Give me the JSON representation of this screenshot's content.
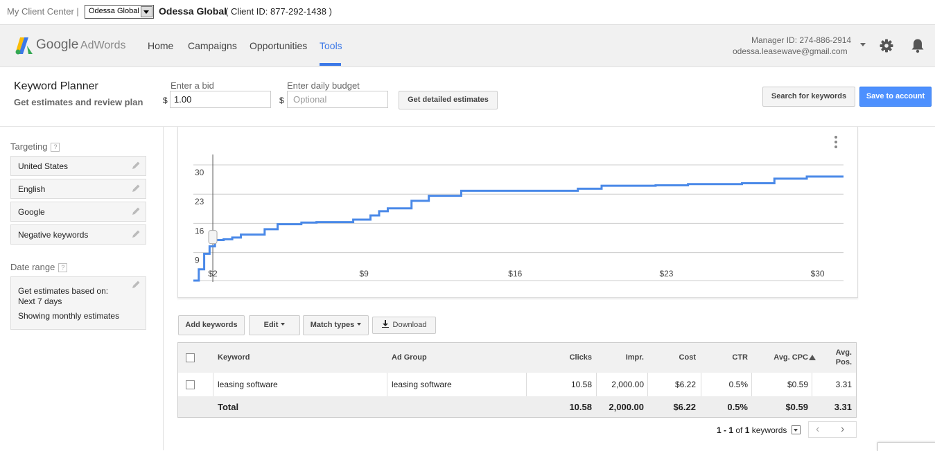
{
  "client_bar": {
    "my_client_center": "My Client Center |",
    "account_select": "Odessa Global",
    "account_name": "Odessa Global",
    "client_id": "( Client ID: 877-292-1438 )"
  },
  "nav": {
    "logo_google": "Google",
    "logo_adwords": "AdWords",
    "tabs": [
      {
        "label": "Home"
      },
      {
        "label": "Campaigns"
      },
      {
        "label": "Opportunities"
      },
      {
        "label": "Tools",
        "active": true
      }
    ],
    "manager_id": "Manager ID: 274-886-2914",
    "manager_email": "odessa.leasewave@gmail.com",
    "icons": [
      "gear-icon",
      "bell-icon"
    ]
  },
  "planner": {
    "title": "Keyword Planner",
    "subtitle": "Get estimates and review plan",
    "bid_label": "Enter a bid",
    "bid_currency": "$",
    "bid_value": "1.00",
    "budget_label": "Enter daily budget",
    "budget_currency": "$",
    "budget_placeholder": "Optional",
    "detail_button": "Get detailed estimates",
    "search_button": "Search for keywords",
    "save_button": "Save to account"
  },
  "sidebar": {
    "targeting_label": "Targeting",
    "help_glyph": "?",
    "targeting_items": [
      "United States",
      "English",
      "Google",
      "Negative keywords"
    ],
    "date_label": "Date range",
    "date_line1": "Get estimates based on:",
    "date_line2": "Next 7 days",
    "date_line3": "Showing monthly estimates"
  },
  "chart_data": {
    "type": "line",
    "x_ticks": [
      "$2",
      "$9",
      "$16",
      "$23",
      "$30"
    ],
    "x_tick_values": [
      2,
      9,
      16,
      23,
      30
    ],
    "y_ticks": [
      "9",
      "16",
      "23",
      "30"
    ],
    "y_tick_values": [
      9,
      16,
      23,
      30
    ],
    "xlim": [
      1.1,
      31.2
    ],
    "ylim": [
      2.3,
      30
    ],
    "selected_bid": 2.0,
    "accent_color": "#4a89e8",
    "series": [
      {
        "step": true,
        "x": [
          1.1,
          1.35,
          1.6,
          1.85,
          2.1,
          2.5,
          2.9,
          3.3,
          4.4,
          5.0,
          6.1,
          6.8,
          8.5,
          9.3,
          9.7,
          10.1,
          11.2,
          12.0,
          13.5,
          15.0,
          17.0,
          18.3,
          18.9,
          20.0,
          21.0,
          22.5,
          24.0,
          26.5,
          28.0,
          29.5,
          31.2
        ],
        "y": [
          2.3,
          5.0,
          8.7,
          10.5,
          12.0,
          12.2,
          12.6,
          13.3,
          14.6,
          15.8,
          16.2,
          16.3,
          16.9,
          17.9,
          18.9,
          19.6,
          21.4,
          22.6,
          23.8,
          23.8,
          23.8,
          23.8,
          24.3,
          25.0,
          25.0,
          25.1,
          25.4,
          25.6,
          26.7,
          27.2,
          27.2
        ]
      }
    ]
  },
  "toolbar": {
    "add_keywords": "Add keywords",
    "edit": "Edit",
    "match_types": "Match types",
    "download": "Download"
  },
  "table": {
    "headers": {
      "keyword": "Keyword",
      "ad_group": "Ad Group",
      "clicks": "Clicks",
      "impr": "Impr.",
      "cost": "Cost",
      "ctr": "CTR",
      "avg_cpc": "Avg. CPC",
      "avg_pos_1": "Avg.",
      "avg_pos_2": "Pos."
    },
    "rows": [
      {
        "keyword": "leasing software",
        "ad_group": "leasing software",
        "clicks": "10.58",
        "impr": "2,000.00",
        "cost": "$6.22",
        "ctr": "0.5%",
        "avg_cpc": "$0.59",
        "avg_pos": "3.31"
      }
    ],
    "total": {
      "label": "Total",
      "clicks": "10.58",
      "impr": "2,000.00",
      "cost": "$6.22",
      "ctr": "0.5%",
      "avg_cpc": "$0.59",
      "avg_pos": "3.31"
    }
  },
  "pagination": {
    "range": "1 - 1",
    "of_label": "of",
    "total": "1",
    "unit": "keywords",
    "prev": "‹",
    "next": "›"
  }
}
